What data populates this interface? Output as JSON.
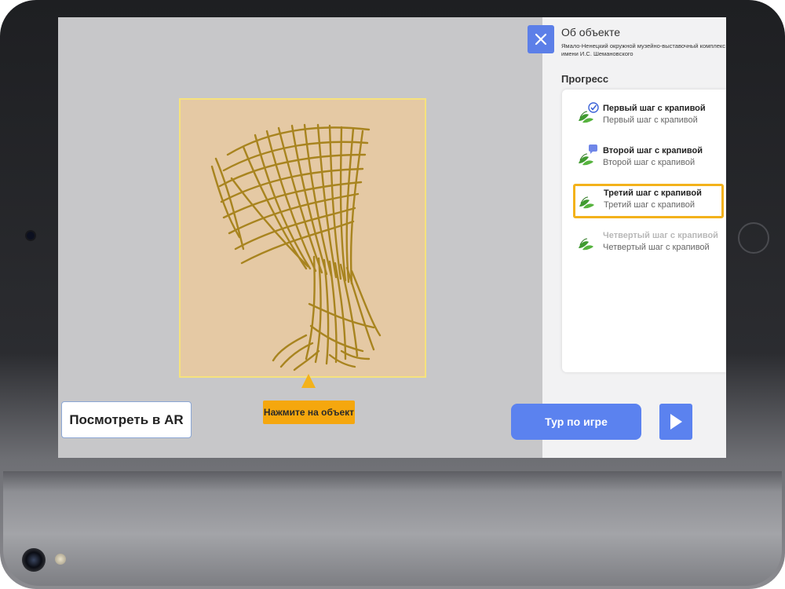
{
  "ar_button": {
    "label": "Посмотреть в AR"
  },
  "hint": {
    "label": "Нажмите на объект"
  },
  "panel": {
    "title": "Об объекте",
    "subtitle": "Ямало-Ненецкий окружной музейно-выставочный комплекс имени И.С. Шемановского",
    "progress_label": "Прогресс",
    "steps": [
      {
        "title": "Первый шаг с крапивой",
        "subtitle": "Первый шаг с крапивой",
        "state": "completed"
      },
      {
        "title": "Второй шаг с крапивой",
        "subtitle": "Второй шаг с крапивой",
        "state": "in-progress"
      },
      {
        "title": "Третий шаг с крапивой",
        "subtitle": "Третий шаг с крапивой",
        "state": "active"
      },
      {
        "title": "Четвертый шаг с крапивой",
        "subtitle": "Четвертый шаг с крапивой",
        "state": "locked"
      }
    ]
  },
  "tour_button": {
    "label": "Тур по игре"
  },
  "icons": {
    "close": "close-icon",
    "play": "play-icon",
    "step": "nettle-leaf-icon",
    "completed_badge": "checkmark-bubble-icon",
    "in_progress_badge": "speech-bubble-icon",
    "pointer": "arrow-up-icon"
  },
  "colors": {
    "accent": "#5b82ef",
    "highlight": "#f3b21b",
    "object_fill": "#a8841f",
    "object_background": "#e5c9a4",
    "leaf": "#3f9a2f"
  }
}
